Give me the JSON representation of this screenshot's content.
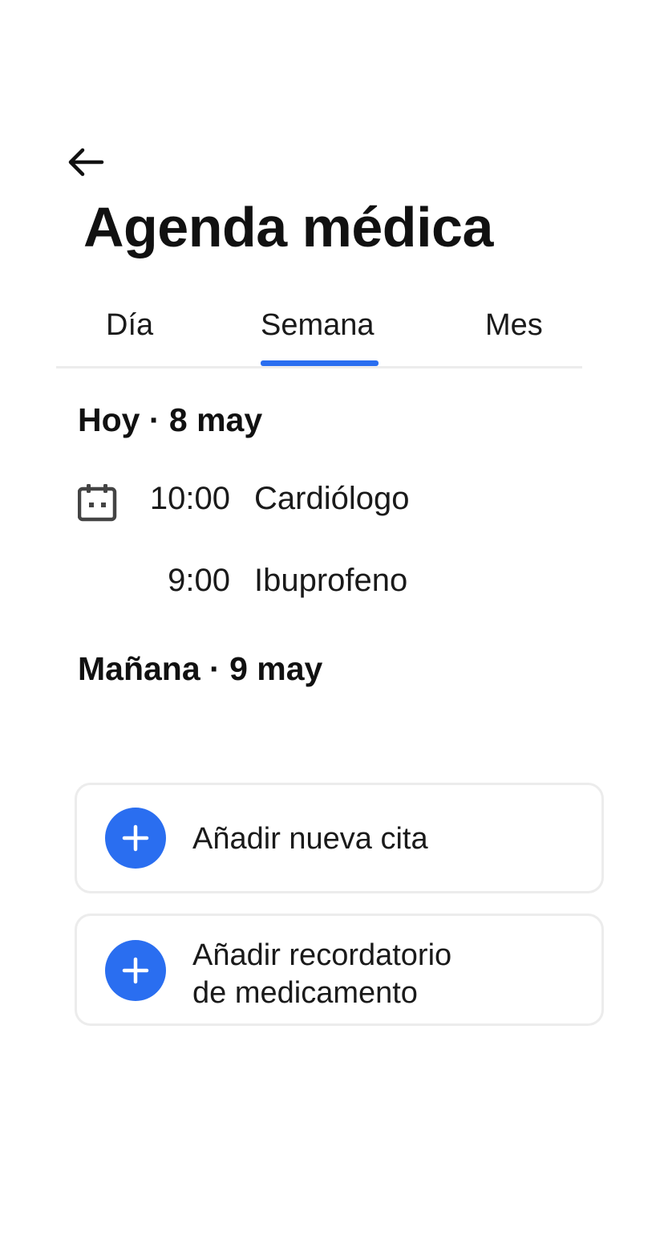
{
  "header": {
    "back_icon": "arrow-left-icon",
    "title": "Agenda médica"
  },
  "tabs": [
    {
      "label": "Día",
      "selected": false
    },
    {
      "label": "Semana",
      "selected": true
    },
    {
      "label": "Mes",
      "selected": false
    }
  ],
  "accent_color": "#2a6ef0",
  "sections": [
    {
      "heading": "Hoy · 8 may",
      "events": [
        {
          "icon": "calendar-icon",
          "time": "10:00",
          "title": "Cardiólogo"
        },
        {
          "icon": "",
          "time": "9:00",
          "title": "Ibuprofeno"
        }
      ]
    },
    {
      "heading": "Mañana · 9 may",
      "events": []
    }
  ],
  "actions": [
    {
      "icon": "plus-icon",
      "label_lines": [
        "Añadir nueva cita"
      ]
    },
    {
      "icon": "plus-icon",
      "label_lines": [
        "Añadir recordatorio",
        "de medicamento"
      ]
    }
  ]
}
